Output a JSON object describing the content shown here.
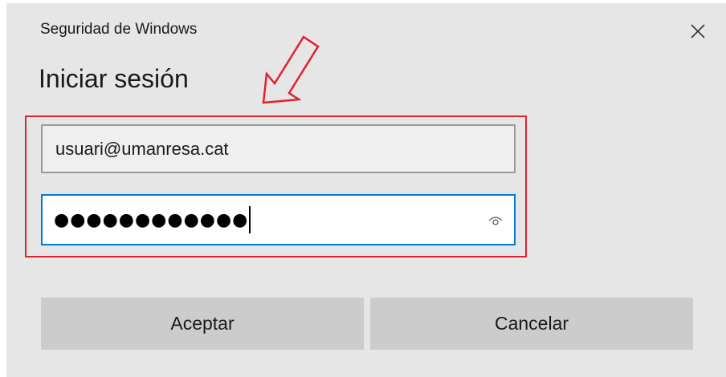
{
  "dialog": {
    "app_title": "Seguridad de Windows",
    "heading": "Iniciar sesión",
    "username_value": "usuari@umanresa.cat",
    "password_mask": "●●●●●●●●●●●●",
    "accept_label": "Aceptar",
    "cancel_label": "Cancelar"
  },
  "icons": {
    "close": "close-icon",
    "reveal": "eye-icon",
    "annotation": "arrow-annotation"
  },
  "colors": {
    "highlight": "#e0212f",
    "focus": "#0078d7"
  }
}
